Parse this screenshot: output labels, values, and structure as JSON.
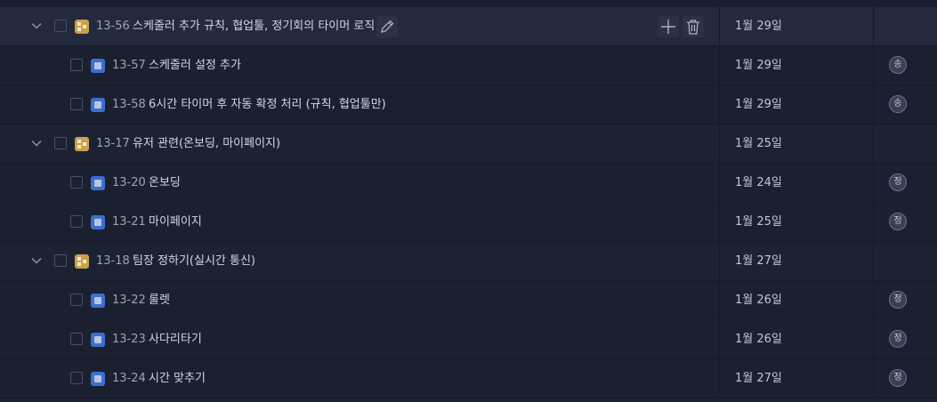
{
  "rows": [
    {
      "key": "13-56",
      "title": "스케줄러 추가 규칙, 협업툴, 정기회의 타이머 로직",
      "date": "1월 29일",
      "assignee": ""
    },
    {
      "key": "13-57",
      "title": "스케줄러 설정 추가",
      "date": "1월 29일",
      "assignee": "송"
    },
    {
      "key": "13-58",
      "title": "6시간 타이머 후 자동 확정 처리 (규칙, 협업툴만)",
      "date": "1월 29일",
      "assignee": "송"
    },
    {
      "key": "13-17",
      "title": "유저 관련(온보딩, 마이페이지)",
      "date": "1월 25일",
      "assignee": ""
    },
    {
      "key": "13-20",
      "title": "온보딩",
      "date": "1월 24일",
      "assignee": "정"
    },
    {
      "key": "13-21",
      "title": "마이페이지",
      "date": "1월 25일",
      "assignee": "정"
    },
    {
      "key": "13-18",
      "title": "팀장 정하기(실시간 통신)",
      "date": "1월 27일",
      "assignee": ""
    },
    {
      "key": "13-22",
      "title": "룰렛",
      "date": "1월 26일",
      "assignee": "정"
    },
    {
      "key": "13-23",
      "title": "사다리타기",
      "date": "1월 26일",
      "assignee": "정"
    },
    {
      "key": "13-24",
      "title": "시간 맞추기",
      "date": "1월 27일",
      "assignee": "정"
    }
  ],
  "icons": {
    "expand": "chevron-down-icon",
    "epic": "epic-type-icon",
    "task": "task-type-icon",
    "edit": "pencil-icon",
    "add": "plus-icon",
    "delete": "trash-icon"
  },
  "colors": {
    "background": "#1d2233",
    "hover_row": "#232a3d",
    "epic_icon": "#c9a24a",
    "task_icon": "#3b6fd1"
  }
}
